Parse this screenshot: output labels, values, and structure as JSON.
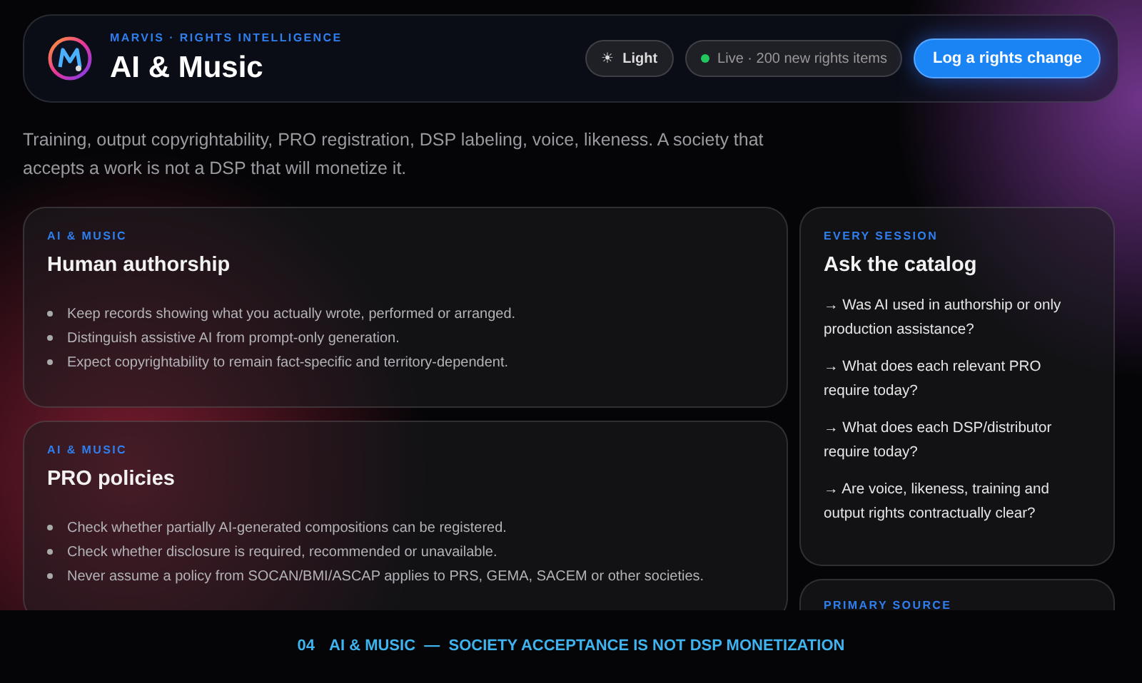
{
  "header": {
    "eyebrow": "MARVIS · RIGHTS INTELLIGENCE",
    "title": "AI & Music",
    "theme_toggle": {
      "icon": "☀",
      "label": "Light"
    },
    "live": {
      "on": true,
      "label": "Live · 200 new rights items"
    },
    "action": "Log a rights change"
  },
  "intro": "Training, output copyrightability, PRO registration, DSP labeling, voice, likeness. A society that accepts a work is not a DSP that will monetize it.",
  "cards": [
    {
      "eyebrow": "AI & MUSIC",
      "title": "Human authorship",
      "items": [
        "Keep records showing what you actually wrote, performed or arranged.",
        "Distinguish assistive AI from prompt-only generation.",
        "Expect copyrightability to remain fact-specific and territory-dependent."
      ]
    },
    {
      "eyebrow": "AI & MUSIC",
      "title": "PRO policies",
      "items": [
        "Check whether partially AI-generated compositions can be registered.",
        "Check whether disclosure is required, recommended or unavailable.",
        "Never assume a policy from SOCAN/BMI/ASCAP applies to PRS, GEMA, SACEM or other societies."
      ]
    }
  ],
  "side": {
    "eyebrow": "EVERY SESSION",
    "title": "Ask the catalog",
    "questions": [
      "→ Was AI used in authorship or only production assistance?",
      "→ What does each relevant PRO require today?",
      "→ What does each DSP/distributor require today?",
      "→ Are voice, likeness, training and output rights contractually clear?"
    ]
  },
  "side_next": {
    "eyebrow": "PRIMARY SOURCE"
  },
  "caption": {
    "number": "04",
    "text": "AI & MUSIC  —  SOCIETY ACCEPTANCE IS NOT DSP MONETIZATION"
  }
}
